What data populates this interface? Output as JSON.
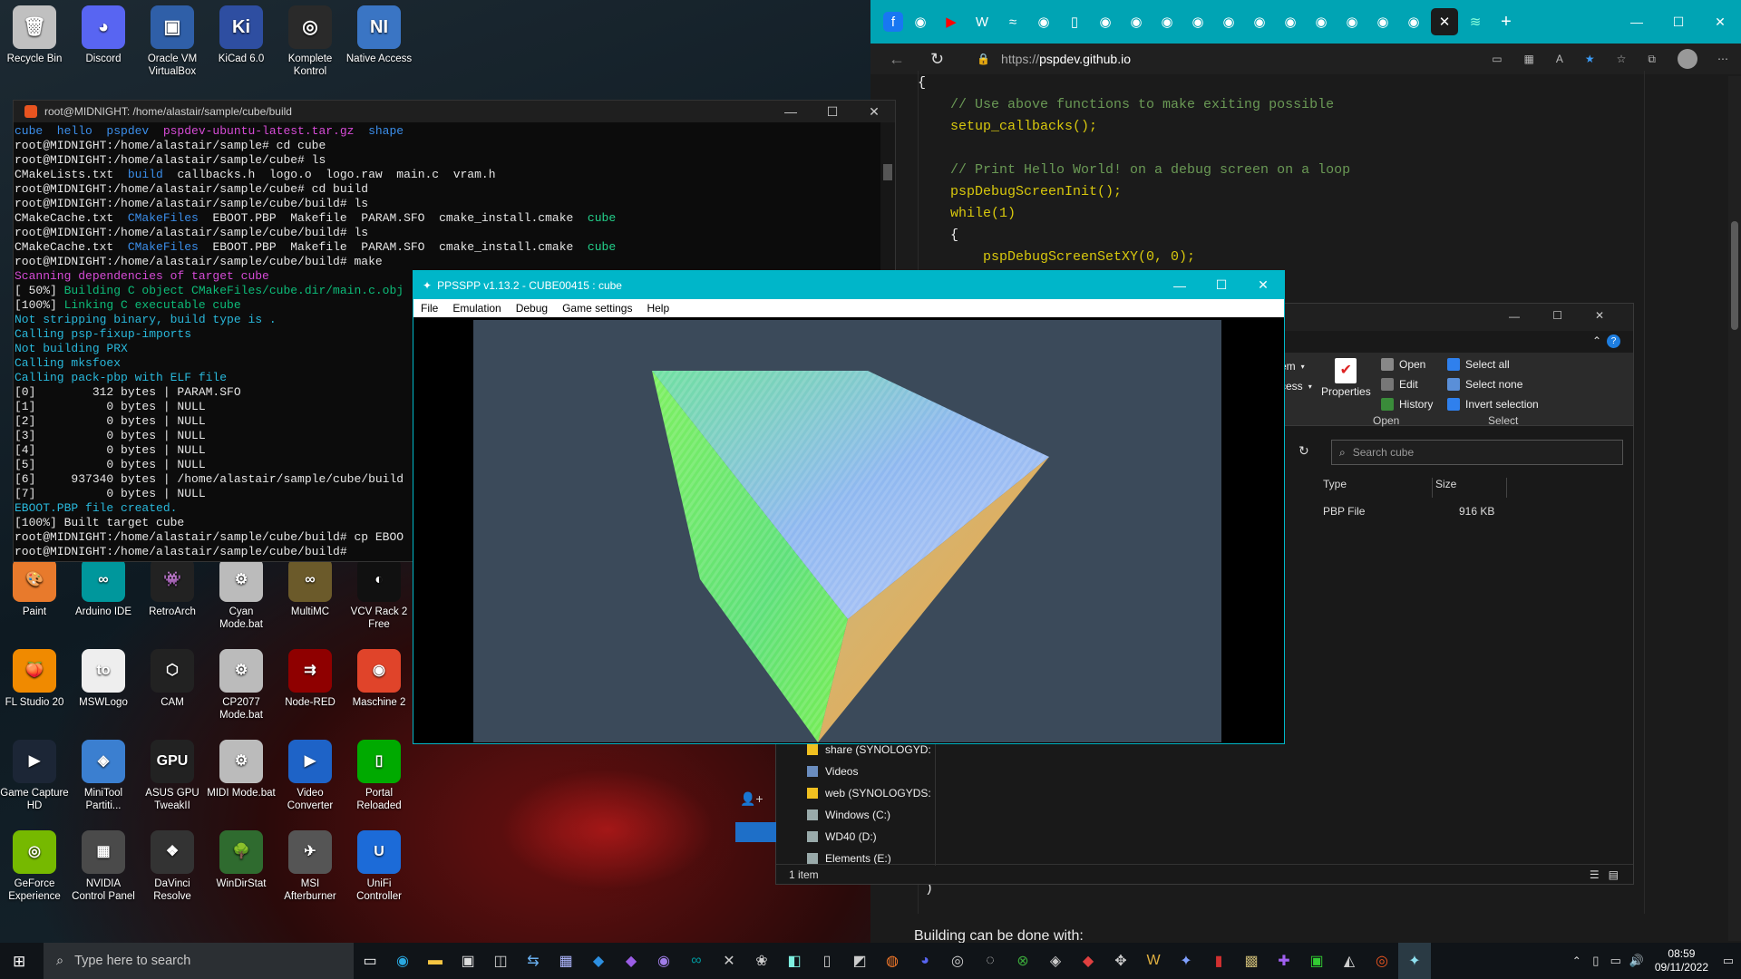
{
  "desktop_icons_top": [
    {
      "label": "Recycle Bin",
      "icon": "recycle-bin-icon",
      "color": "#c0c0c0",
      "glyph": "🗑"
    },
    {
      "label": "Discord",
      "icon": "discord-icon",
      "color": "#5865f2",
      "glyph": "◕"
    },
    {
      "label": "Oracle VM VirtualBox",
      "icon": "virtualbox-icon",
      "color": "#2f5fa8",
      "glyph": "▣"
    },
    {
      "label": "KiCad 6.0",
      "icon": "kicad-icon",
      "color": "#2e4ea1",
      "glyph": "Ki"
    },
    {
      "label": "Komplete Kontrol",
      "icon": "komplete-kontrol-icon",
      "color": "#2a2a2a",
      "glyph": "◎"
    },
    {
      "label": "Native Access",
      "icon": "native-access-icon",
      "color": "#3a75c4",
      "glyph": "NI"
    }
  ],
  "desktop_icons_grid": [
    {
      "label": "Paint",
      "icon": "paint-icon",
      "color": "#e87a2c",
      "glyph": "🎨"
    },
    {
      "label": "Arduino IDE",
      "icon": "arduino-icon",
      "color": "#00979c",
      "glyph": "∞"
    },
    {
      "label": "RetroArch",
      "icon": "retroarch-icon",
      "color": "#222",
      "glyph": "👾"
    },
    {
      "label": "Cyan Mode.bat",
      "icon": "bat-file-icon",
      "color": "#bbb",
      "glyph": "⚙"
    },
    {
      "label": "MultiMC",
      "icon": "multimc-icon",
      "color": "#6b5a2a",
      "glyph": "∞"
    },
    {
      "label": "VCV Rack 2 Free",
      "icon": "vcv-rack-icon",
      "color": "#111",
      "glyph": "◐"
    },
    {
      "label": "FL Studio 20",
      "icon": "fl-studio-icon",
      "color": "#f08a00",
      "glyph": "🍑"
    },
    {
      "label": "MSWLogo",
      "icon": "mswlogo-icon",
      "color": "#eee",
      "glyph": "to"
    },
    {
      "label": "CAM",
      "icon": "cam-icon",
      "color": "#222",
      "glyph": "⬡"
    },
    {
      "label": "CP2077 Mode.bat",
      "icon": "bat-file-icon",
      "color": "#bbb",
      "glyph": "⚙"
    },
    {
      "label": "Node-RED",
      "icon": "node-red-icon",
      "color": "#8f0000",
      "glyph": "⇉"
    },
    {
      "label": "Maschine 2",
      "icon": "maschine-icon",
      "color": "#e0442a",
      "glyph": "◉"
    },
    {
      "label": "Game Capture HD",
      "icon": "game-capture-icon",
      "color": "#1c2636",
      "glyph": "▶"
    },
    {
      "label": "MiniTool Partiti...",
      "icon": "minitool-icon",
      "color": "#3b7fd0",
      "glyph": "◈"
    },
    {
      "label": "ASUS GPU TweakII",
      "icon": "asus-gpu-icon",
      "color": "#222",
      "glyph": "GPU"
    },
    {
      "label": "MIDI Mode.bat",
      "icon": "bat-file-icon",
      "color": "#bbb",
      "glyph": "⚙"
    },
    {
      "label": "Video Converter",
      "icon": "video-converter-icon",
      "color": "#1e63c7",
      "glyph": "▶"
    },
    {
      "label": "Portal Reloaded",
      "icon": "portal-icon",
      "color": "#0a0",
      "glyph": "▯"
    },
    {
      "label": "GeForce Experience",
      "icon": "geforce-icon",
      "color": "#76b900",
      "glyph": "◎"
    },
    {
      "label": "NVIDIA Control Panel",
      "icon": "nvidia-icon",
      "color": "#4a4a4a",
      "glyph": "▦"
    },
    {
      "label": "DaVinci Resolve",
      "icon": "davinci-icon",
      "color": "#333",
      "glyph": "❖"
    },
    {
      "label": "WinDirStat",
      "icon": "windirstat-icon",
      "color": "#2f6b2f",
      "glyph": "🌳"
    },
    {
      "label": "MSI Afterburner",
      "icon": "msi-afterburner-icon",
      "color": "#555",
      "glyph": "✈"
    },
    {
      "label": "UniFi Controller",
      "icon": "unifi-icon",
      "color": "#1c6bd8",
      "glyph": "U"
    }
  ],
  "terminal": {
    "title": "root@MIDNIGHT: /home/alastair/sample/cube/build",
    "lines": [
      [
        [
          "c-blue",
          "cube  hello  pspdev  "
        ],
        [
          "c-mag",
          "pspdev-ubuntu-latest.tar.gz  "
        ],
        [
          "c-blue",
          "shape"
        ]
      ],
      [
        [
          "c-white",
          "root@MIDNIGHT:/home/alastair/sample# cd cube"
        ]
      ],
      [
        [
          "c-white",
          "root@MIDNIGHT:/home/alastair/sample/cube# ls"
        ]
      ],
      [
        [
          "c-white",
          "CMakeLists.txt  "
        ],
        [
          "c-blue",
          "build"
        ],
        [
          "c-white",
          "  callbacks.h  logo.o  logo.raw  main.c  vram.h"
        ]
      ],
      [
        [
          "c-white",
          "root@MIDNIGHT:/home/alastair/sample/cube# cd build"
        ]
      ],
      [
        [
          "c-white",
          "root@MIDNIGHT:/home/alastair/sample/cube/build# ls"
        ]
      ],
      [
        [
          "c-white",
          "CMakeCache.txt  "
        ],
        [
          "c-blue",
          "CMakeFiles"
        ],
        [
          "c-white",
          "  EBOOT.PBP  Makefile  PARAM.SFO  cmake_install.cmake  "
        ],
        [
          "c-green",
          "cube"
        ]
      ],
      [
        [
          "c-white",
          "root@MIDNIGHT:/home/alastair/sample/cube/build# ls"
        ]
      ],
      [
        [
          "c-white",
          "CMakeCache.txt  "
        ],
        [
          "c-blue",
          "CMakeFiles"
        ],
        [
          "c-white",
          "  EBOOT.PBP  Makefile  PARAM.SFO  cmake_install.cmake  "
        ],
        [
          "c-green",
          "cube"
        ]
      ],
      [
        [
          "c-white",
          "root@MIDNIGHT:/home/alastair/sample/cube/build# make"
        ]
      ],
      [
        [
          "c-mag",
          "Scanning dependencies of target cube"
        ]
      ],
      [
        [
          "c-white",
          "[ 50%] "
        ],
        [
          "c-lgreen",
          "Building C object CMakeFiles/cube.dir/main.c.obj"
        ]
      ],
      [
        [
          "c-white",
          "[100%] "
        ],
        [
          "c-lgreen",
          "Linking C executable cube"
        ]
      ],
      [
        [
          "c-cyan",
          "Not stripping binary, build type is ."
        ]
      ],
      [
        [
          "c-cyan",
          "Calling psp-fixup-imports"
        ]
      ],
      [
        [
          "c-cyan",
          "Not building PRX"
        ]
      ],
      [
        [
          "c-cyan",
          "Calling mksfoex"
        ]
      ],
      [
        [
          "c-cyan",
          "Calling pack-pbp with ELF file"
        ]
      ],
      [
        [
          "c-white",
          "[0]        312 bytes | PARAM.SFO"
        ]
      ],
      [
        [
          "c-white",
          "[1]          0 bytes | NULL"
        ]
      ],
      [
        [
          "c-white",
          "[2]          0 bytes | NULL"
        ]
      ],
      [
        [
          "c-white",
          "[3]          0 bytes | NULL"
        ]
      ],
      [
        [
          "c-white",
          "[4]          0 bytes | NULL"
        ]
      ],
      [
        [
          "c-white",
          "[5]          0 bytes | NULL"
        ]
      ],
      [
        [
          "c-white",
          "[6]     937340 bytes | /home/alastair/sample/cube/build"
        ]
      ],
      [
        [
          "c-white",
          "[7]          0 bytes | NULL"
        ]
      ],
      [
        [
          "c-cyan",
          "EBOOT.PBP file created."
        ]
      ],
      [
        [
          "c-white",
          "[100%] Built target cube"
        ]
      ],
      [
        [
          "c-white",
          "root@MIDNIGHT:/home/alastair/sample/cube/build# cp EBOO"
        ]
      ],
      [
        [
          "c-white",
          "root@MIDNIGHT:/home/alastair/sample/cube/build# "
        ]
      ]
    ]
  },
  "browser": {
    "url_prefix": "https://",
    "url_host": "pspdev.github.io",
    "code_lines": [
      [
        "code-b",
        "{"
      ],
      [
        "code-c",
        "    // Use above functions to make exiting possible"
      ],
      [
        "code-t",
        "    setup_callbacks();"
      ],
      [
        "code-b",
        ""
      ],
      [
        "code-c",
        "    // Print Hello World! on a debug screen on a loop"
      ],
      [
        "code-t",
        "    pspDebugScreenInit();"
      ],
      [
        "code-t",
        "    while(1)"
      ],
      [
        "code-b",
        "    {"
      ],
      [
        "code-t",
        "        pspDebugScreenSetXY(0, 0);"
      ]
    ],
    "close_brace": ")",
    "footer_text": "Building can be done with:"
  },
  "explorer": {
    "ribbon_open": {
      "open": "Open",
      "edit": "Edit",
      "history": "History",
      "properties": "Properties",
      "group": "Open",
      "item": "em",
      "access": "cess"
    },
    "ribbon_select": {
      "select_all": "Select all",
      "select_none": "Select none",
      "invert": "Invert selection",
      "group": "Select"
    },
    "search_placeholder": "Search cube",
    "columns": {
      "type": "Type",
      "size": "Size"
    },
    "file": {
      "type": "PBP File",
      "size": "916 KB"
    },
    "nav_items": [
      "share (SYNOLOGYD:",
      "Videos",
      "web (SYNOLOGYDS:",
      "Windows (C:)",
      "WD40 (D:)",
      "Elements (E:)"
    ],
    "status": "1 item"
  },
  "ppsspp": {
    "title": "PPSSPP v1.13.2 - CUBE00415 : cube",
    "menu": [
      "File",
      "Emulation",
      "Debug",
      "Game settings",
      "Help"
    ]
  },
  "taskbar": {
    "search_placeholder": "Type here to search",
    "time": "08:59",
    "date": "09/11/2022"
  }
}
